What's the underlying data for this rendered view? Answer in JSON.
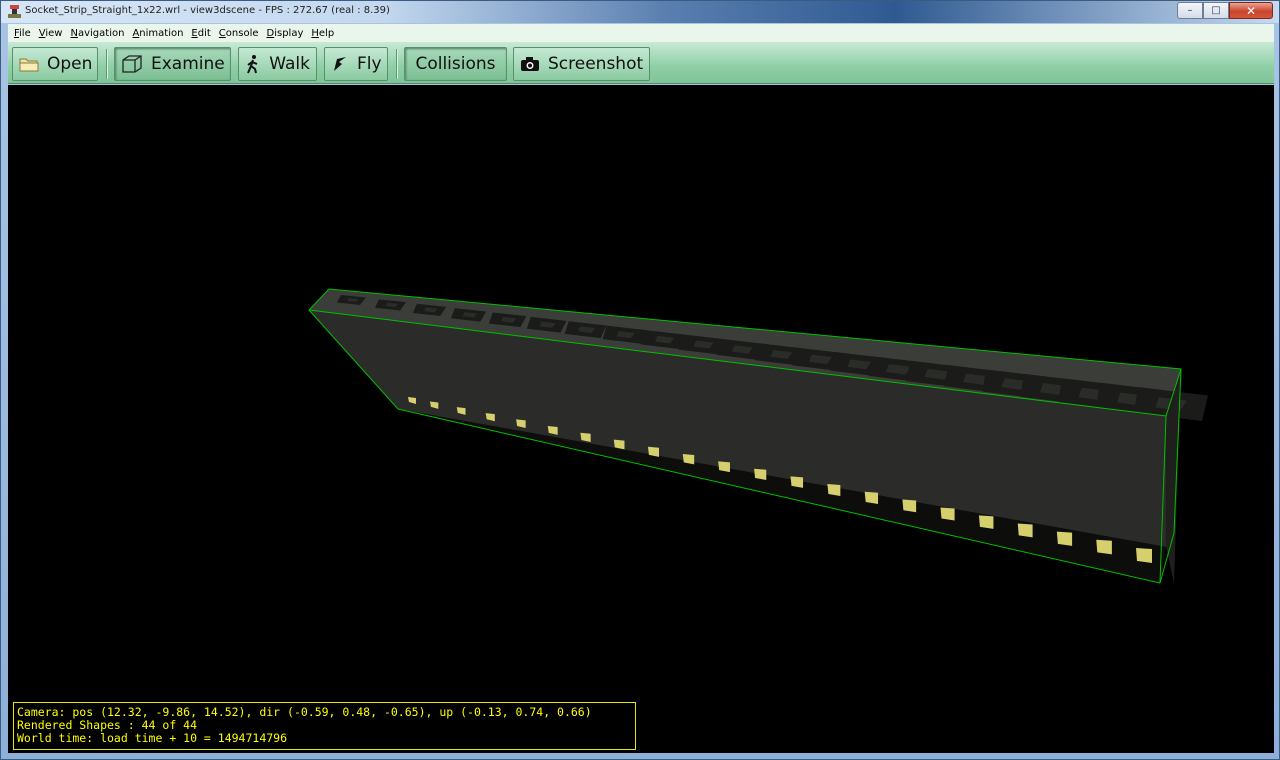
{
  "window": {
    "title": "Socket_Strip_Straight_1x22.wrl - view3dscene - FPS : 272.67 (real : 8.39)",
    "minimize": "–",
    "maximize": "□",
    "close": "✕"
  },
  "menu": {
    "items": [
      {
        "first": "F",
        "rest": "ile"
      },
      {
        "first": "V",
        "rest": "iew"
      },
      {
        "first": "N",
        "rest": "avigation"
      },
      {
        "first": "A",
        "rest": "nimation"
      },
      {
        "first": "E",
        "rest": "dit"
      },
      {
        "first": "C",
        "rest": "onsole"
      },
      {
        "first": "D",
        "rest": "isplay"
      },
      {
        "first": "H",
        "rest": "elp"
      }
    ]
  },
  "toolbar": {
    "open": "Open",
    "examine": "Examine",
    "walk": "Walk",
    "fly": "Fly",
    "collisions": "Collisions",
    "screenshot": "Screenshot",
    "icons": [
      "folder-icon",
      "cube-icon",
      "walk-icon",
      "fly-icon",
      "camera-icon"
    ]
  },
  "colors": {
    "bounding_box": "#00c000",
    "pin": "#d6cf6e",
    "status_text": "#ffff00",
    "toolbar": "#8fcfa6"
  },
  "status": {
    "camera": "Camera: pos (12.32, -9.86, 14.52), dir (-0.59, 0.48, -0.65), up (-0.13, 0.74, 0.66)",
    "shapes": "Rendered Shapes : 44 of 44",
    "world_time": "World time: load time + 10 = 1494714796"
  },
  "scene": {
    "socket_count": 22,
    "pin_count": 22
  }
}
